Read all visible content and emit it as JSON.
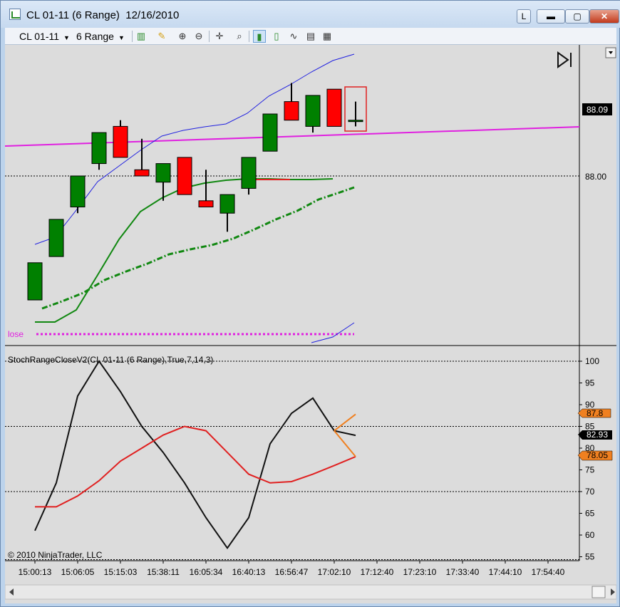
{
  "window": {
    "title": "CL 01-11 (6 Range)  12/16/2010",
    "buttons": {
      "l": "L",
      "minimize": "▬",
      "maximize": "▢",
      "close": "✕"
    }
  },
  "toolbar": {
    "instrument": "CL 01-11",
    "interval": "6 Range",
    "icons": [
      "bar-type-icon",
      "pencil-draw-icon",
      "zoom-in-icon",
      "zoom-out-icon",
      "crosshair-icon",
      "magnifier-icon",
      "candles-icon",
      "bars-icon",
      "line-icon",
      "properties-icon",
      "data-box-icon"
    ]
  },
  "price_panel": {
    "last_price_label": "88.09",
    "price_level_label": "88.00",
    "close_label": "lose",
    "colors": {
      "up": "#008000",
      "down": "#ff0000",
      "magenta": "#e020e0",
      "blue": "#2020e0",
      "green": "#118811"
    }
  },
  "stoch_panel": {
    "title": "StochRangeCloseV2(CL  01-11 (6 Range),True,7,14,3)",
    "labels": {
      "orange1": "87.8",
      "black": "82.93",
      "orange2": "78.05"
    },
    "copyright": "© 2010 NinjaTrader, LLC"
  },
  "chart_data": [
    {
      "type": "candlestick",
      "title": "CL 01-11 (6 Range)",
      "candles": [
        {
          "o": 87.8,
          "h": 87.8,
          "l": 87.86,
          "c": 87.86
        },
        {
          "o": 87.87,
          "h": 87.93,
          "l": 87.87,
          "c": 87.93
        },
        {
          "o": 87.95,
          "h": 88.0,
          "l": 87.94,
          "c": 88.0
        },
        {
          "o": 88.02,
          "h": 88.07,
          "l": 88.01,
          "c": 88.07
        },
        {
          "o": 88.08,
          "h": 88.09,
          "l": 88.03,
          "c": 88.03
        },
        {
          "o": 88.01,
          "h": 88.06,
          "l": 88.0,
          "c": 88.0
        },
        {
          "o": 87.99,
          "h": 88.02,
          "l": 87.96,
          "c": 88.02
        },
        {
          "o": 88.03,
          "h": 88.03,
          "l": 87.97,
          "c": 87.97
        },
        {
          "o": 87.96,
          "h": 88.01,
          "l": 87.95,
          "c": 87.95
        },
        {
          "o": 87.94,
          "h": 87.97,
          "l": 87.91,
          "c": 87.97
        },
        {
          "o": 87.98,
          "h": 88.03,
          "l": 87.97,
          "c": 88.03
        },
        {
          "o": 88.04,
          "h": 88.1,
          "l": 88.04,
          "c": 88.1
        },
        {
          "o": 88.12,
          "h": 88.15,
          "l": 88.09,
          "c": 88.09
        },
        {
          "o": 88.08,
          "h": 88.13,
          "l": 88.07,
          "c": 88.13
        },
        {
          "o": 88.14,
          "h": 88.14,
          "l": 88.08,
          "c": 88.08
        },
        {
          "o": 88.09,
          "h": 88.12,
          "l": 88.08,
          "c": 88.09
        }
      ],
      "x_ticks": [
        "15:00:13",
        "15:06:05",
        "15:15:03",
        "15:38:11",
        "16:05:34",
        "16:40:13",
        "16:56:47",
        "17:02:10",
        "17:12:40",
        "17:23:10",
        "17:33:40",
        "17:44:10",
        "17:54:40"
      ],
      "price_labels": [
        88.09,
        88.0
      ]
    },
    {
      "type": "line",
      "title": "StochRangeCloseV2(CL  01-11 (6 Range),True,7,14,3)",
      "y_ticks": [
        100,
        95,
        90,
        85,
        80,
        75,
        70,
        65,
        60,
        55
      ],
      "ylim": [
        54,
        102
      ],
      "hlines": [
        85,
        70
      ],
      "series": [
        {
          "color": "#111111",
          "values": [
            61,
            72,
            92,
            100,
            93,
            85,
            79,
            72,
            64,
            57,
            64,
            81,
            88,
            91.5,
            84,
            82.93
          ]
        },
        {
          "color": "#e02020",
          "values": [
            66.5,
            66.5,
            69,
            72.5,
            77,
            80,
            83,
            85,
            84,
            79,
            74,
            72,
            72.3,
            74,
            76,
            78.05
          ]
        },
        {
          "color": "#f08020",
          "values": [
            null,
            null,
            null,
            null,
            null,
            null,
            null,
            null,
            null,
            null,
            null,
            null,
            null,
            null,
            84,
            87.8
          ]
        },
        {
          "color": "#f08020",
          "values": [
            null,
            null,
            null,
            null,
            null,
            null,
            null,
            null,
            null,
            null,
            null,
            null,
            null,
            null,
            84,
            78.05
          ]
        }
      ]
    }
  ]
}
